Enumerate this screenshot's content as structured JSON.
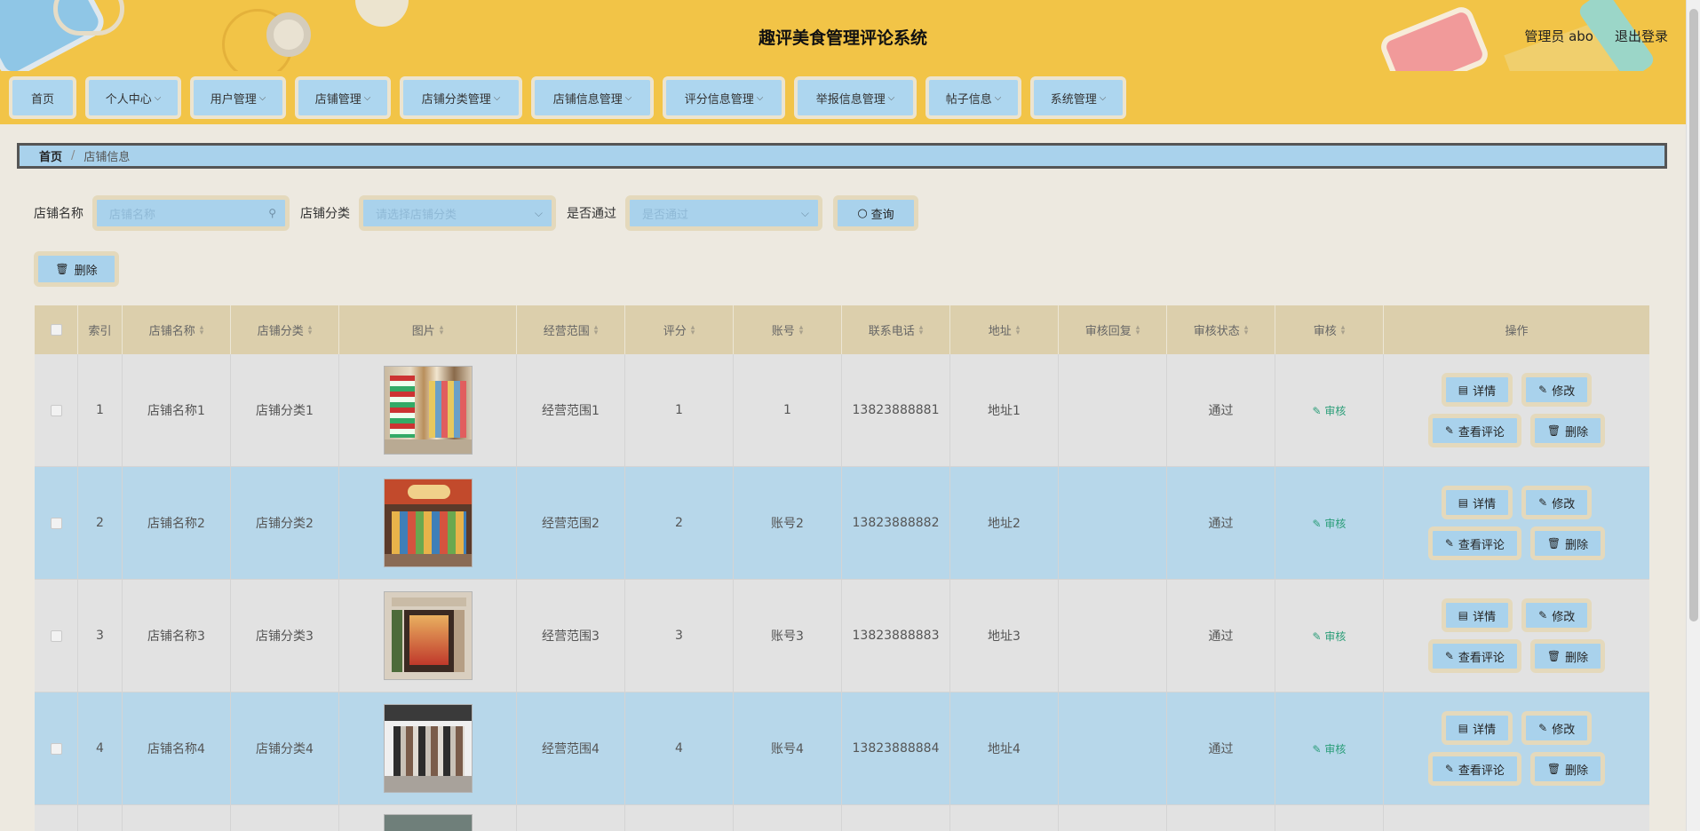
{
  "header": {
    "title": "趣评美食管理评论系统",
    "admin_label": "管理员 abo",
    "logout_label": "退出登录"
  },
  "nav": {
    "items": [
      {
        "label": "首页"
      },
      {
        "label": "个人中心"
      },
      {
        "label": "用户管理"
      },
      {
        "label": "店铺管理"
      },
      {
        "label": "店铺分类管理"
      },
      {
        "label": "店铺信息管理"
      },
      {
        "label": "评分信息管理"
      },
      {
        "label": "举报信息管理"
      },
      {
        "label": "帖子信息"
      },
      {
        "label": "系统管理"
      }
    ]
  },
  "breadcrumb": {
    "home": "首页",
    "sep": "/",
    "current": "店铺信息"
  },
  "search": {
    "name_label": "店铺名称",
    "name_placeholder": "店铺名称",
    "category_label": "店铺分类",
    "category_placeholder": "请选择店铺分类",
    "approved_label": "是否通过",
    "approved_placeholder": "是否通过",
    "query_label": "查询"
  },
  "toolbar": {
    "delete_label": "删除"
  },
  "table": {
    "columns": [
      "索引",
      "店铺名称",
      "店铺分类",
      "图片",
      "经营范围",
      "评分",
      "账号",
      "联系电话",
      "地址",
      "审核回复",
      "审核状态",
      "审核",
      "操作"
    ],
    "rows": [
      {
        "index": "1",
        "name": "店铺名称1",
        "category": "店铺分类1",
        "scope": "经营范围1",
        "score": "1",
        "account": "1",
        "phone": "13823888881",
        "address": "地址1",
        "reply": "",
        "status": "通过",
        "audit": "审核"
      },
      {
        "index": "2",
        "name": "店铺名称2",
        "category": "店铺分类2",
        "scope": "经营范围2",
        "score": "2",
        "account": "账号2",
        "phone": "13823888882",
        "address": "地址2",
        "reply": "",
        "status": "通过",
        "audit": "审核"
      },
      {
        "index": "3",
        "name": "店铺名称3",
        "category": "店铺分类3",
        "scope": "经营范围3",
        "score": "3",
        "account": "账号3",
        "phone": "13823888883",
        "address": "地址3",
        "reply": "",
        "status": "通过",
        "audit": "审核"
      },
      {
        "index": "4",
        "name": "店铺名称4",
        "category": "店铺分类4",
        "scope": "经营范围4",
        "score": "4",
        "account": "账号4",
        "phone": "13823888884",
        "address": "地址4",
        "reply": "",
        "status": "通过",
        "audit": "审核"
      }
    ],
    "actions": {
      "detail": "详情",
      "edit": "修改",
      "view_comments": "查看评论",
      "delete": "删除"
    }
  }
}
